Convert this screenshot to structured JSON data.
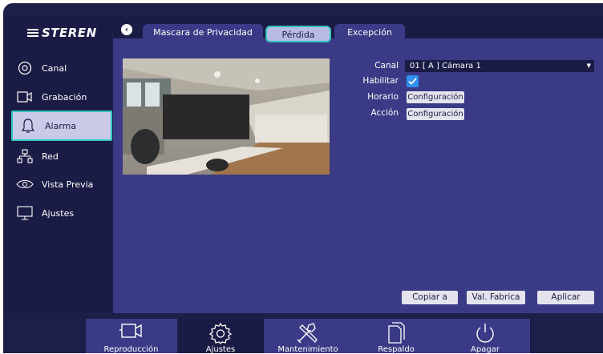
{
  "brand": {
    "logo_text": "STEREN"
  },
  "sidebar": {
    "items": [
      {
        "label": "Canal",
        "icon": "camera-lens-icon",
        "active": false
      },
      {
        "label": "Grabación",
        "icon": "video-camera-icon",
        "active": false
      },
      {
        "label": "Alarma",
        "icon": "bell-icon",
        "active": true
      },
      {
        "label": "Red",
        "icon": "network-icon",
        "active": false
      },
      {
        "label": "Vista Previa",
        "icon": "eye-icon",
        "active": false
      },
      {
        "label": "Ajustes",
        "icon": "monitor-icon",
        "active": false
      }
    ]
  },
  "tabs": [
    {
      "label": "Mascara de Privacidad",
      "active": false
    },
    {
      "label": "Pérdida",
      "active": true
    },
    {
      "label": "Excepción",
      "active": false
    }
  ],
  "form": {
    "canal_label": "Canal",
    "canal_value": "01 [ A ] Cámara 1",
    "habilitar_label": "Habilitar",
    "habilitar_checked": true,
    "horario_label": "Horario",
    "horario_button": "Configuración",
    "accion_label": "Acción",
    "accion_button": "Configuración"
  },
  "actions": {
    "copy": "Copiar a",
    "defaults": "Val. Fabrica",
    "apply": "Aplicar"
  },
  "taskbar": {
    "items": [
      {
        "label": "Reproducción",
        "icon": "video-camera-icon",
        "active": false
      },
      {
        "label": "Ajustes",
        "icon": "gear-icon",
        "active": true
      },
      {
        "label": "Mantenimiento",
        "icon": "tools-icon",
        "active": false
      },
      {
        "label": "Respaldo",
        "icon": "copy-files-icon",
        "active": false
      },
      {
        "label": "Apagar",
        "icon": "power-icon",
        "active": false
      }
    ]
  },
  "colors": {
    "background": "#1e1f49",
    "panel": "#3a3a86",
    "accent_border": "#33c7c0",
    "checkbox": "#2f8ff2"
  }
}
